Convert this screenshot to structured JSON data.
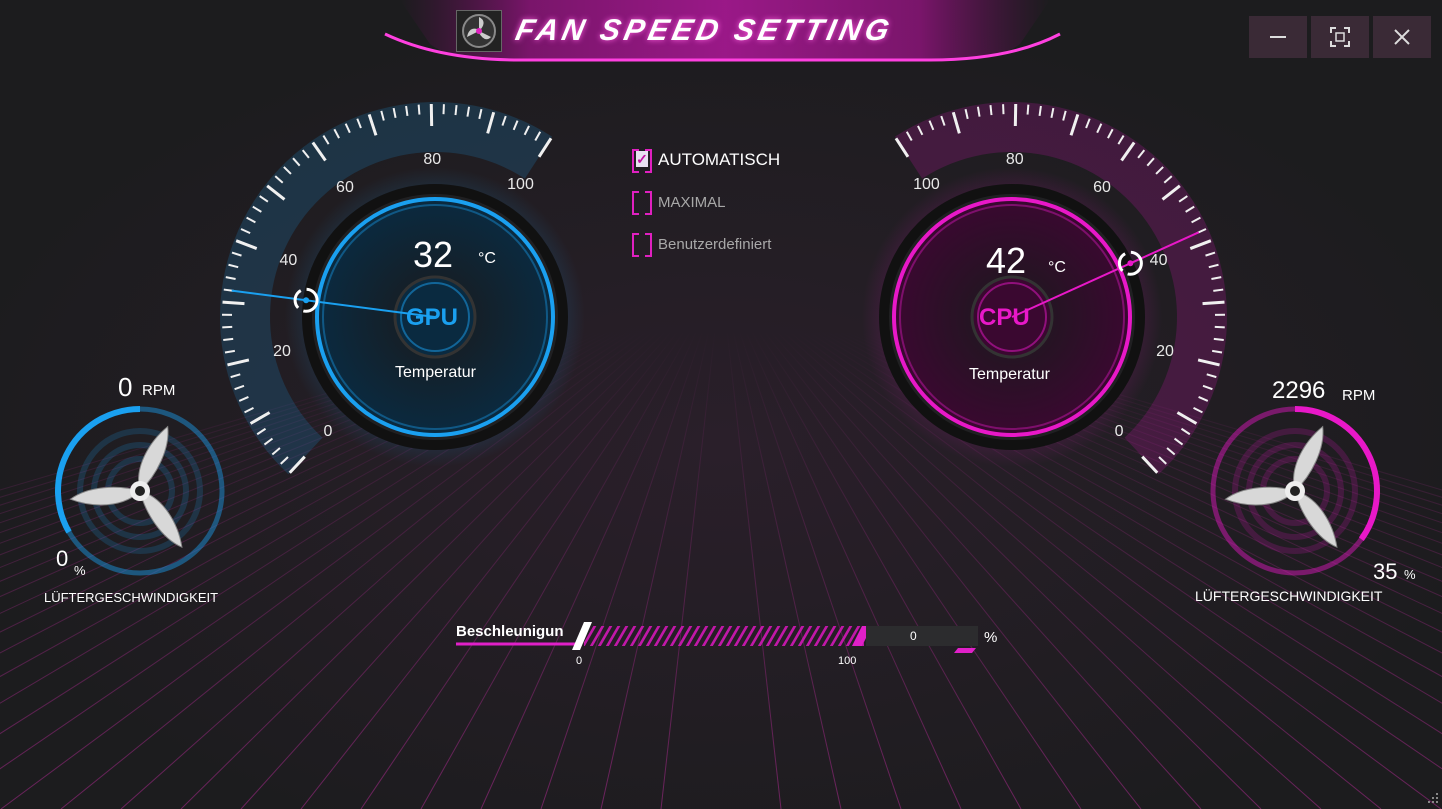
{
  "window": {
    "title": "FAN SPEED SETTING",
    "controls": {
      "minimize": "minimize-icon",
      "maximize": "maximize-icon",
      "close": "close-icon"
    }
  },
  "colors": {
    "gpu": "#1aa0f0",
    "cpu": "#e818c8",
    "background": "#1e1e20"
  },
  "modes": [
    {
      "label": "AUTOMATISCH",
      "checked": true
    },
    {
      "label": "MAXIMAL",
      "checked": false
    },
    {
      "label": "Benutzerdefiniert",
      "checked": false
    }
  ],
  "gpu": {
    "name": "GPU",
    "temperature": "32",
    "temp_unit": "°C",
    "temp_label": "Temperatur",
    "scale_labels": [
      "0",
      "20",
      "40",
      "60",
      "80",
      "100"
    ],
    "temp_value": 32
  },
  "cpu": {
    "name": "CPU",
    "temperature": "42",
    "temp_unit": "°C",
    "temp_label": "Temperatur",
    "scale_labels": [
      "0",
      "20",
      "40",
      "60",
      "80",
      "100"
    ],
    "temp_value": 42
  },
  "gpu_fan": {
    "rpm": "0",
    "rpm_unit": "RPM",
    "percent": "0",
    "percent_unit": "%",
    "label": "LÜFTERGESCHWINDIGKEIT",
    "level": 0
  },
  "cpu_fan": {
    "rpm": "2296",
    "rpm_unit": "RPM",
    "percent": "35",
    "percent_unit": "%",
    "label": "LÜFTERGESCHWINDIGKEIT",
    "level": 0.35
  },
  "acceleration": {
    "label": "Beschleunigun",
    "value": "0",
    "unit": "%",
    "min": "0",
    "max": "100"
  }
}
